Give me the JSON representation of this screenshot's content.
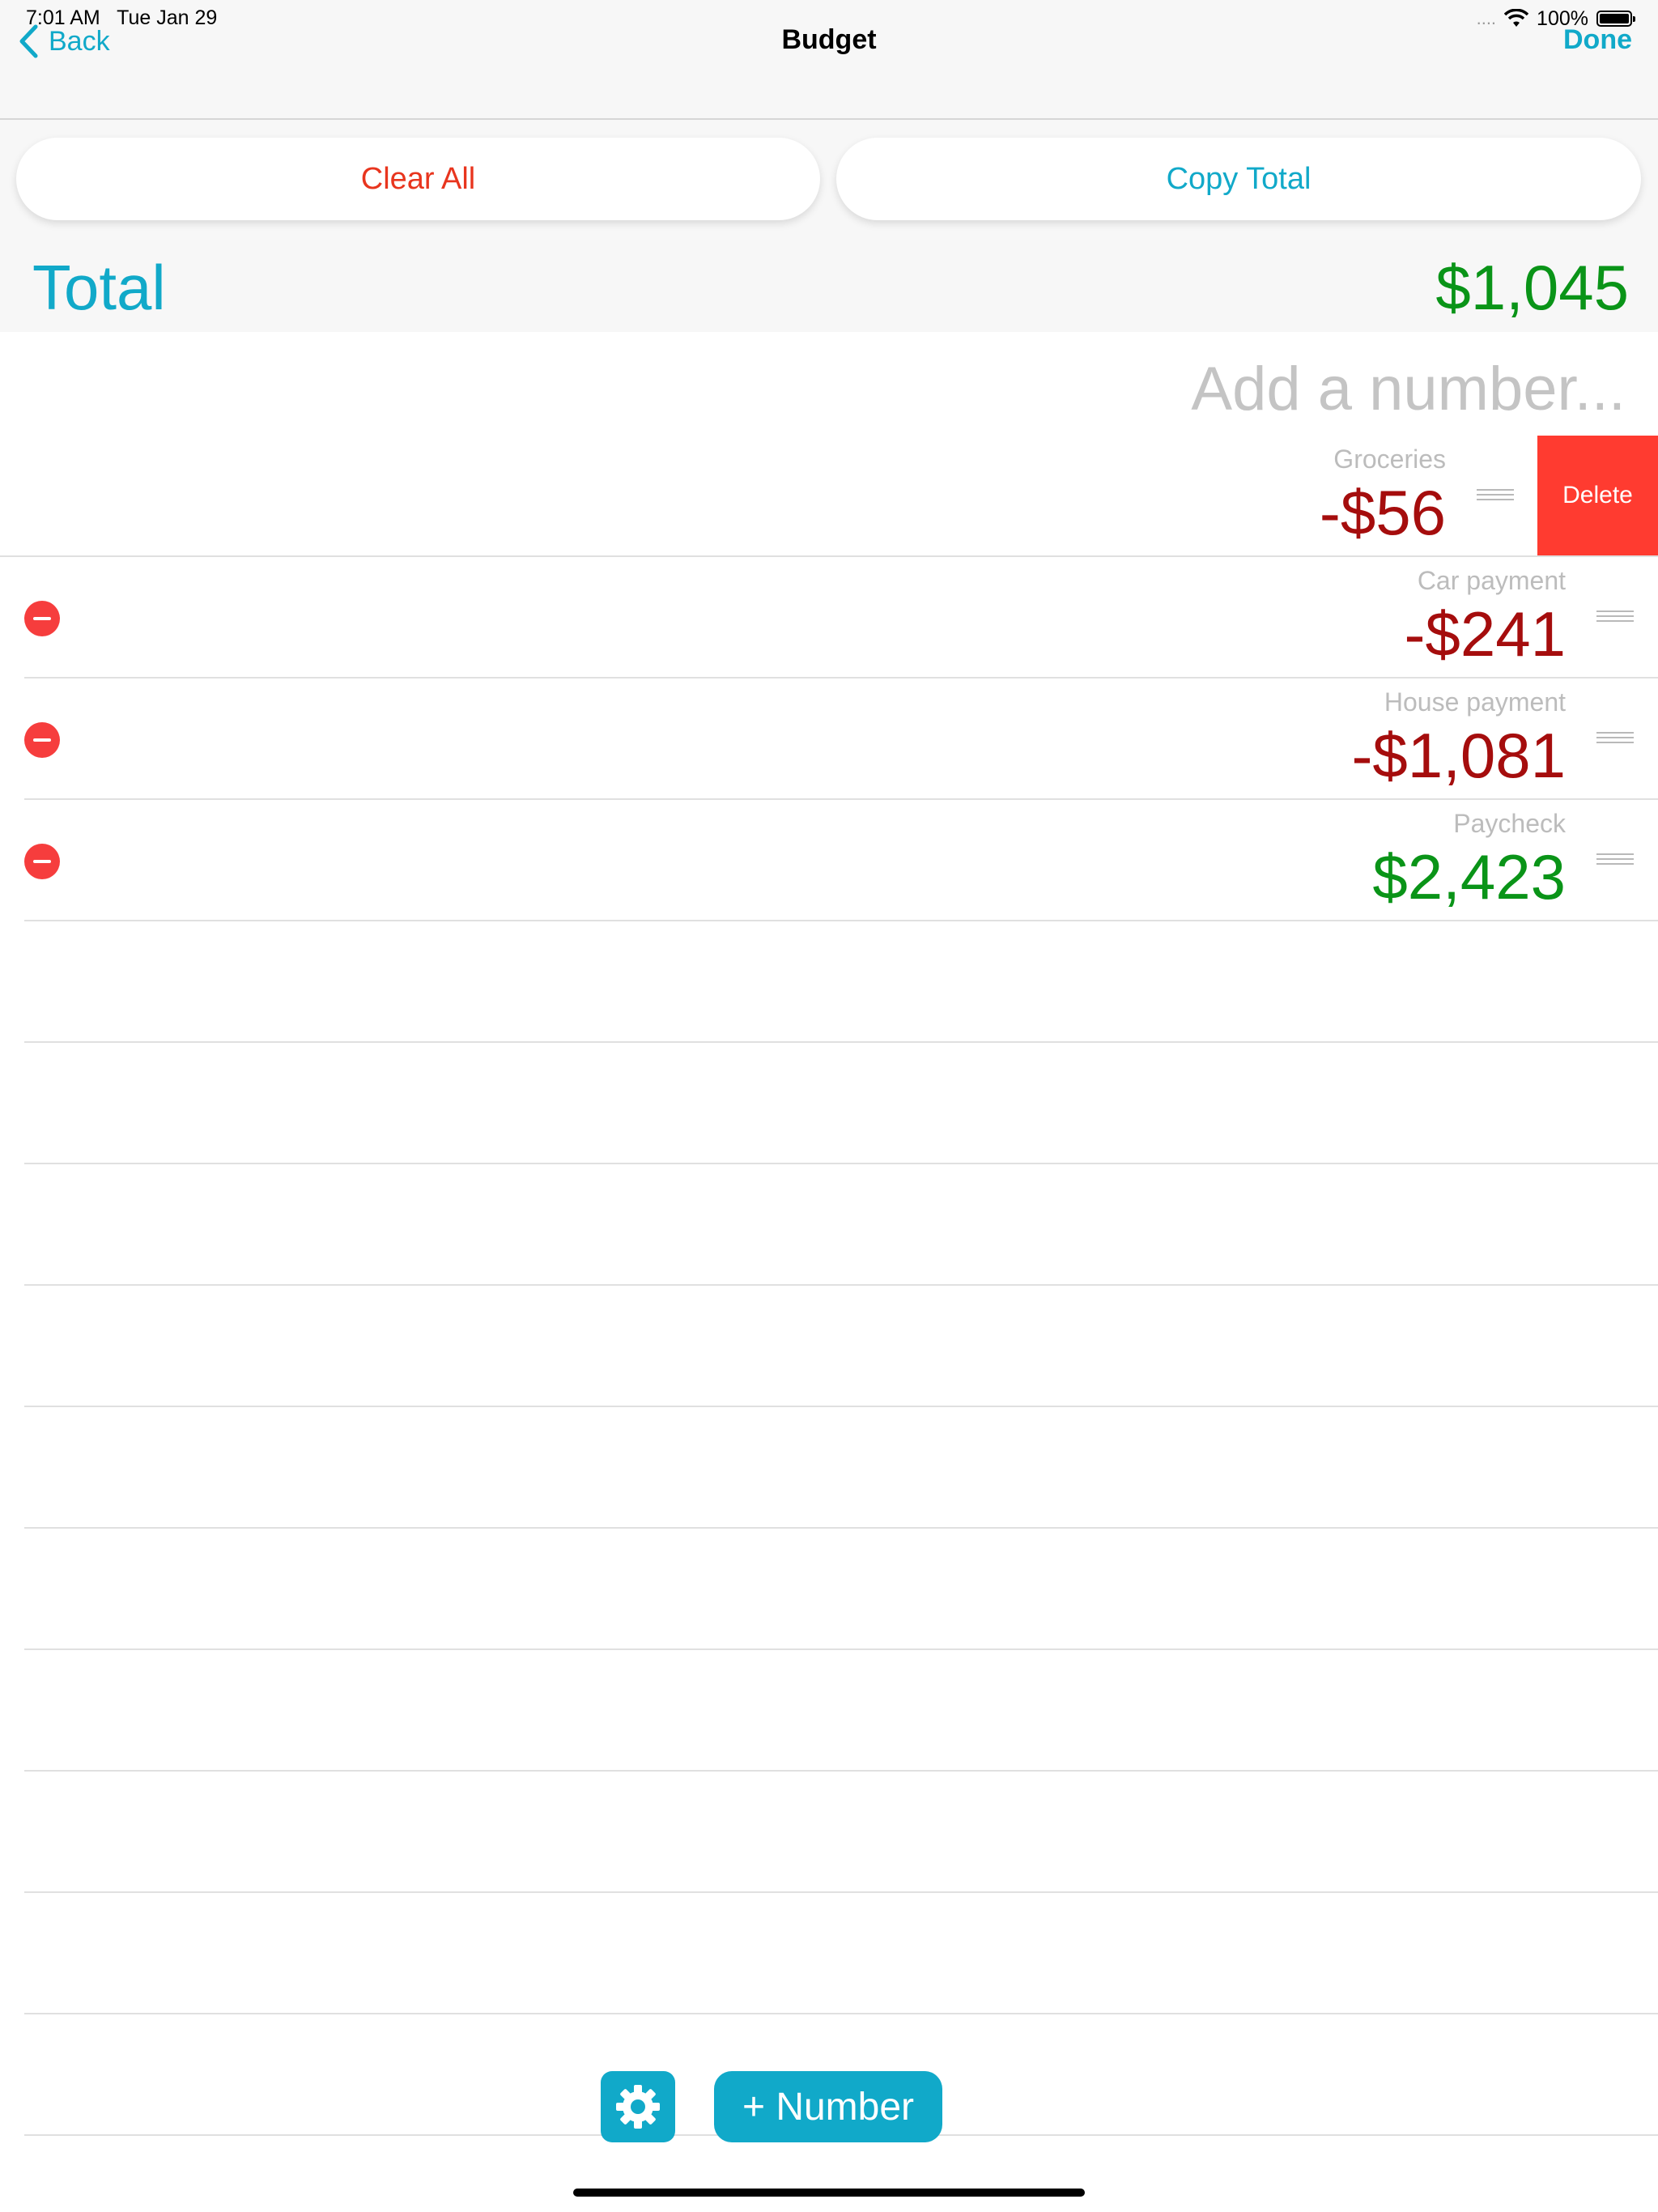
{
  "status_bar": {
    "time": "7:01 AM",
    "date": "Tue Jan 29",
    "signal": "....",
    "battery": "100%",
    "wifi_icon": "wifi-icon",
    "battery_icon": "battery-icon"
  },
  "nav": {
    "back_label": "Back",
    "title": "Budget",
    "done_label": "Done"
  },
  "actions": {
    "clear_all": "Clear All",
    "copy_total": "Copy Total"
  },
  "total": {
    "label": "Total",
    "value": "$1,045"
  },
  "input": {
    "placeholder": "Add a number..."
  },
  "rows": [
    {
      "label": "Groceries",
      "value": "-$56",
      "sign": "negative",
      "swiped": true
    },
    {
      "label": "Car payment",
      "value": "-$241",
      "sign": "negative"
    },
    {
      "label": "House payment",
      "value": "-$1,081",
      "sign": "negative"
    },
    {
      "label": "Paycheck",
      "value": "$2,423",
      "sign": "positive"
    }
  ],
  "swipe_action": {
    "delete_label": "Delete"
  },
  "toolbar": {
    "settings_icon": "gear-icon",
    "add_number_label": "+ Number"
  },
  "colors": {
    "accent": "#11a9c9",
    "negative": "#a50d0d",
    "positive": "#0a9418",
    "delete": "#ff3b30",
    "clear": "#e8351e"
  }
}
